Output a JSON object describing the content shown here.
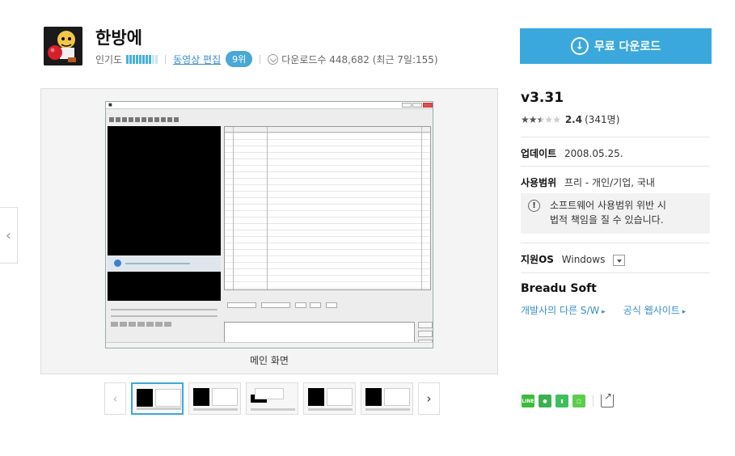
{
  "header": {
    "title": "한방에",
    "popularity_label": "인기도",
    "popularity_level": 0.8,
    "category": "동영상 편집",
    "rank": "9위",
    "downloads_text": "다운로드수 448,682 (최근 7일:155)"
  },
  "download_button": {
    "label": "무료 다운로드"
  },
  "viewer": {
    "caption": "메인 화면",
    "thumbnail_count": 5,
    "active_thumbnail": 1
  },
  "info": {
    "version": "v3.31",
    "rating_stars": 2.4,
    "rating_score": "2.4",
    "rating_count": "(341명)",
    "update_label": "업데이트",
    "update_date": "2008.05.25.",
    "license_label": "사용범위",
    "license_value": "프리 - 개인/기업, 국내",
    "warning_line1": "소프트웨어 사용범위 위반 시",
    "warning_line2": "법적 책임을 질 수 있습니다.",
    "os_label": "지원OS",
    "os_value": "Windows",
    "developer": "Breadu Soft",
    "dev_link_other": "개발사의 다른 S/W",
    "dev_link_site": "공식 웹사이트"
  },
  "colors": {
    "accent": "#3aa8dc",
    "link": "#3a8fc9",
    "share_line": "#3bbd3b",
    "share_kakao": "#3cb050",
    "share_bookmark": "#3ec05b",
    "share_band": "#5ccd4a"
  },
  "icons": {
    "download": "download-circle-icon",
    "prev": "chevron-left-icon",
    "next": "chevron-right-icon",
    "warning": "exclamation-icon",
    "share": "share-icon"
  }
}
